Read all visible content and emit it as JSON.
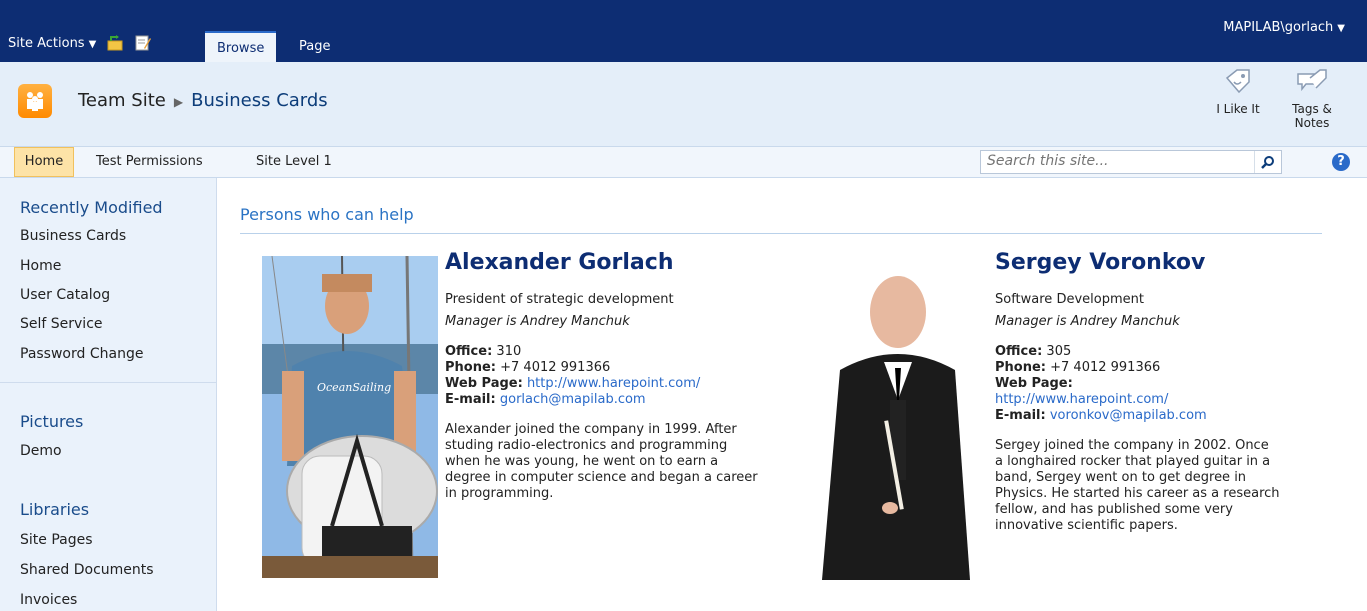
{
  "ribbon": {
    "site_actions": "Site Actions",
    "tabs": [
      "Browse",
      "Page"
    ],
    "user": "MAPILAB\\gorlach"
  },
  "header": {
    "breadcrumb_root": "Team Site",
    "breadcrumb_current": "Business Cards",
    "i_like_it": "I Like It",
    "tags_notes": "Tags & Notes"
  },
  "topnav": {
    "items": [
      "Home",
      "Test Permissions",
      "Site Level 1"
    ],
    "search_placeholder": "Search this site..."
  },
  "sidebar": {
    "recently_modified": "Recently Modified",
    "recent_items": [
      "Business Cards",
      "Home",
      "User Catalog",
      "Self Service",
      "Password Change"
    ],
    "pictures": "Pictures",
    "pictures_items": [
      "Demo"
    ],
    "libraries": "Libraries",
    "libraries_items": [
      "Site Pages",
      "Shared Documents",
      "Invoices"
    ]
  },
  "content": {
    "title": "Persons who can help",
    "cards": [
      {
        "name": "Alexander Gorlach",
        "position": "President of strategic development",
        "manager": "Manager is Andrey Manchuk",
        "office_label": "Office:",
        "office": "310",
        "phone_label": "Phone:",
        "phone": "+7 4012 991366",
        "web_label": "Web Page:",
        "web": "http://www.harepoint.com/",
        "email_label": "E-mail:",
        "email": "gorlach@mapilab.com",
        "bio": "Alexander joined the company in 1999. After studing radio-electronics and programming when he was young, he went on to earn a degree in computer science and began a career in programming."
      },
      {
        "name": "Sergey Voronkov",
        "position": "Software Development",
        "manager": "Manager is Andrey Manchuk",
        "office_label": "Office:",
        "office": "305",
        "phone_label": "Phone:",
        "phone": "+7 4012 991366",
        "web_label": "Web Page:",
        "web": "http://www.harepoint.com/",
        "email_label": "E-mail:",
        "email": "voronkov@mapilab.com",
        "bio": "Sergey joined the company in 2002. Once a longhaired rocker that played guitar in a band, Sergey went on to get degree in Physics. He started his career as a research fellow, and has published some very innovative scientific papers."
      }
    ]
  }
}
